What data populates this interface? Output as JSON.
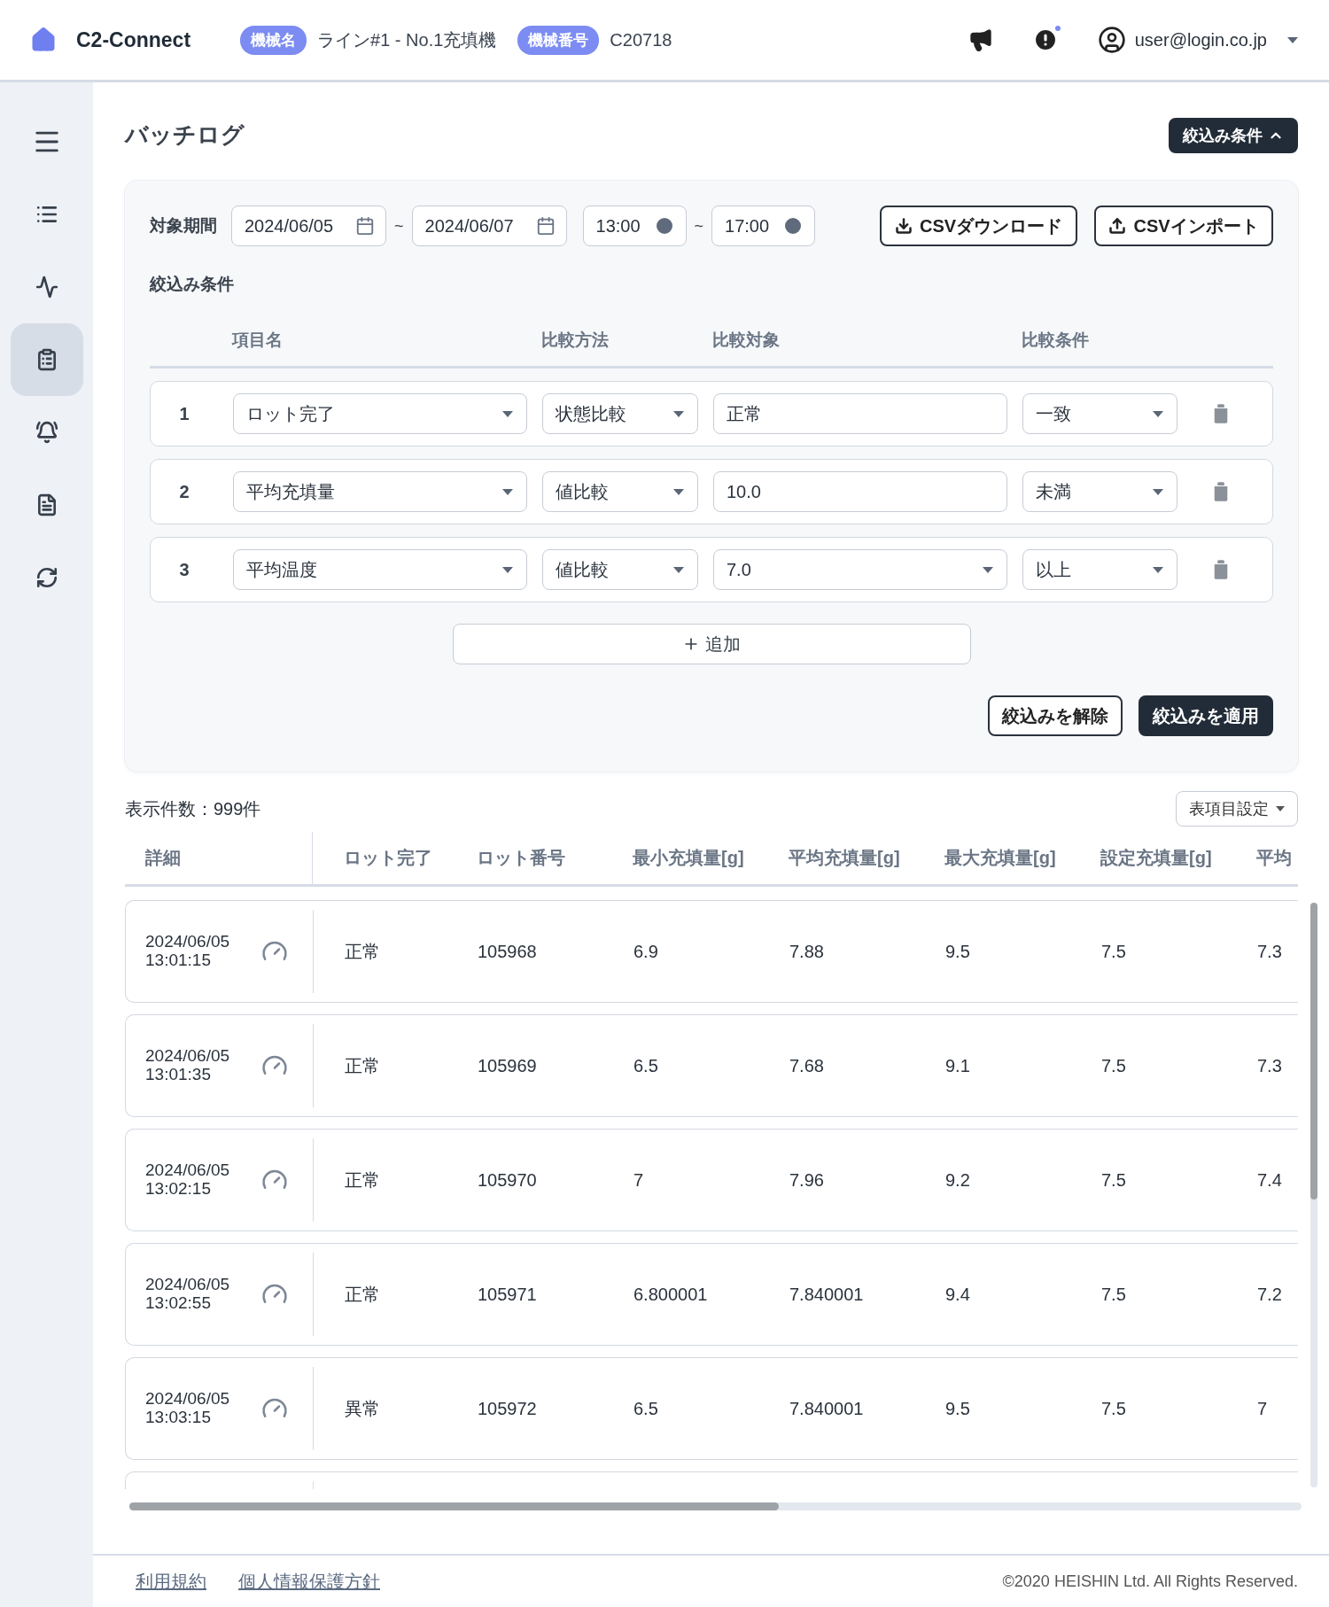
{
  "header": {
    "app_name": "C2-Connect",
    "machine_name_label": "機械名",
    "machine_name": "ライン#1 - No.1充填機",
    "machine_number_label": "機械番号",
    "machine_number": "C20718",
    "notification_dot": true,
    "user": "user@login.co.jp"
  },
  "sidebar": {
    "items": [
      {
        "selected": false
      },
      {
        "selected": false
      },
      {
        "selected": true
      },
      {
        "selected": false
      },
      {
        "selected": false
      },
      {
        "selected": false
      }
    ]
  },
  "page": {
    "title": "バッチログ",
    "filter_toggle": {
      "label": "絞込み条件",
      "expanded": true
    }
  },
  "filter": {
    "period_label": "対象期間",
    "date_from": "2024/06/05",
    "date_sep": "~",
    "date_to": "2024/06/07",
    "time_from": "13:00",
    "time_sep": "~",
    "time_to": "17:00",
    "csv_download": "CSVダウンロード",
    "csv_import": "CSVインポート",
    "conditions_title": "絞込み条件",
    "columns": [
      "項目名",
      "比較方法",
      "比較対象",
      "比較条件"
    ],
    "conditions": [
      {
        "index": "1",
        "item": "ロット完了",
        "method": "状態比較",
        "target": {
          "kind": "input",
          "value": "正常"
        },
        "condition": "一致"
      },
      {
        "index": "2",
        "item": "平均充填量",
        "method": "値比較",
        "target": {
          "kind": "input",
          "value": "10.0"
        },
        "condition": "未満"
      },
      {
        "index": "3",
        "item": "平均温度",
        "method": "値比較",
        "target": {
          "kind": "select",
          "value": "7.0"
        },
        "condition": "以上"
      }
    ],
    "add_button": "追加",
    "clear_button": "絞込みを解除",
    "apply_button": "絞込みを適用"
  },
  "results": {
    "count": "表示件数：999件",
    "column_settings": "表項目設定",
    "columns": [
      "詳細",
      "ロット完了",
      "ロット番号",
      "最小充填量[g]",
      "平均充填量[g]",
      "最大充填量[g]",
      "設定充填量[g]",
      "平均"
    ],
    "rows": [
      {
        "cells": [
          "2024/06/05 13:01:15",
          "正常",
          "105968",
          "6.9",
          "7.88",
          "9.5",
          "7.5",
          "7.3"
        ]
      },
      {
        "cells": [
          "2024/06/05 13:01:35",
          "正常",
          "105969",
          "6.5",
          "7.68",
          "9.1",
          "7.5",
          "7.3"
        ]
      },
      {
        "cells": [
          "2024/06/05 13:02:15",
          "正常",
          "105970",
          "7",
          "7.96",
          "9.2",
          "7.5",
          "7.4"
        ]
      },
      {
        "cells": [
          "2024/06/05 13:02:55",
          "正常",
          "105971",
          "6.800001",
          "7.840001",
          "9.4",
          "7.5",
          "7.2"
        ]
      },
      {
        "cells": [
          "2024/06/05 13:03:15",
          "異常",
          "105972",
          "6.5",
          "7.840001",
          "9.5",
          "7.5",
          "7"
        ]
      }
    ]
  },
  "footer": {
    "links": [
      "利用規約",
      "個人情報保護方針"
    ],
    "copyright": "©2020 HEISHIN Ltd. All Rights Reserved."
  }
}
